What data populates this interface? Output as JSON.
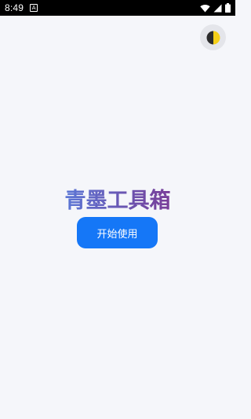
{
  "status_bar": {
    "time": "8:49",
    "notification_icon": "a-square-icon",
    "wifi_icon": "wifi-icon",
    "signal_icon": "cell-signal-icon",
    "battery_icon": "battery-icon"
  },
  "theme_toggle": {
    "icon": "half-moon-theme-icon",
    "colors": {
      "dark_half": "#2b2b2b",
      "light_half": "#f4cf18"
    }
  },
  "main": {
    "title": "青墨工具箱",
    "start_button_label": "开始使用"
  },
  "colors": {
    "background": "#f5f6fa",
    "status_bar": "#000000",
    "button": "#1577f7",
    "title_gradient_start": "#5b77d6",
    "title_gradient_end": "#7a3d98",
    "toggle_background": "#e4e5ea"
  }
}
